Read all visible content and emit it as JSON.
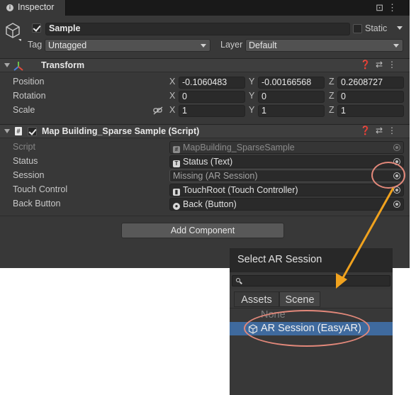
{
  "inspector": {
    "tab_label": "Inspector",
    "gameobject": {
      "name": "Sample",
      "static_label": "Static",
      "tag_label": "Tag",
      "tag_value": "Untagged",
      "layer_label": "Layer",
      "layer_value": "Default"
    },
    "transform": {
      "title": "Transform",
      "position": {
        "label": "Position",
        "x": "-0.1060483",
        "y": "-0.00166568",
        "z": "0.2608727"
      },
      "rotation": {
        "label": "Rotation",
        "x": "0",
        "y": "0",
        "z": "0"
      },
      "scale": {
        "label": "Scale",
        "x": "1",
        "y": "1",
        "z": "1"
      },
      "axes": {
        "x": "X",
        "y": "Y",
        "z": "Z"
      }
    },
    "script_component": {
      "title": "Map Building_Sparse Sample (Script)",
      "fields": [
        {
          "label": "Script",
          "value": "MapBuilding_SparseSample"
        },
        {
          "label": "Status",
          "value": "Status (Text)"
        },
        {
          "label": "Session",
          "value": "Missing (AR Session)"
        },
        {
          "label": "Touch Control",
          "value": "TouchRoot (Touch Controller)"
        },
        {
          "label": "Back Button",
          "value": "Back (Button)"
        }
      ]
    },
    "add_component_label": "Add Component"
  },
  "selector": {
    "title": "Select AR Session",
    "search_value": "",
    "tabs": [
      "Assets",
      "Scene"
    ],
    "items": [
      "None",
      "AR Session (EasyAR)"
    ],
    "selected_index": 1
  },
  "colors": {
    "panel": "#383838",
    "selection": "#3f6a9e",
    "annotation": "#e2887a",
    "arrow": "#f0a21e"
  },
  "icons": [
    "info-icon",
    "lock-icon",
    "menu-icon",
    "gameobject-cube-icon",
    "transform-axes-icon",
    "help-icon",
    "settings-icon",
    "script-icon",
    "text-icon",
    "touch-icon",
    "button-icon",
    "object-picker-icon",
    "search-icon",
    "link-icon"
  ]
}
